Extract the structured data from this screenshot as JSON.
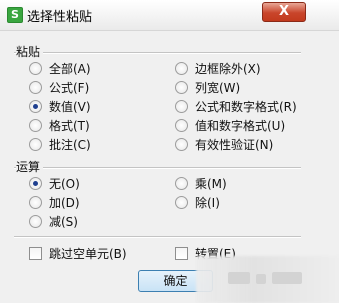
{
  "window": {
    "icon_glyph": "S",
    "title": "选择性粘贴",
    "close_glyph": "X"
  },
  "paste": {
    "group_label": "粘贴",
    "options": [
      {
        "label": "全部(A)",
        "checked": false
      },
      {
        "label": "公式(F)",
        "checked": false
      },
      {
        "label": "数值(V)",
        "checked": true
      },
      {
        "label": "格式(T)",
        "checked": false
      },
      {
        "label": "批注(C)",
        "checked": false
      },
      {
        "label": "边框除外(X)",
        "checked": false
      },
      {
        "label": "列宽(W)",
        "checked": false
      },
      {
        "label": "公式和数字格式(R)",
        "checked": false
      },
      {
        "label": "值和数字格式(U)",
        "checked": false
      },
      {
        "label": "有效性验证(N)",
        "checked": false
      }
    ]
  },
  "operation": {
    "group_label": "运算",
    "options": [
      {
        "label": "无(O)",
        "checked": true
      },
      {
        "label": "加(D)",
        "checked": false
      },
      {
        "label": "减(S)",
        "checked": false
      },
      {
        "label": "乘(M)",
        "checked": false
      },
      {
        "label": "除(I)",
        "checked": false
      }
    ]
  },
  "checkboxes": {
    "skip_blanks": {
      "label": "跳过空单元(B)",
      "checked": false
    },
    "transpose": {
      "label": "转置(E)",
      "checked": false
    }
  },
  "buttons": {
    "ok_label": "确定"
  }
}
